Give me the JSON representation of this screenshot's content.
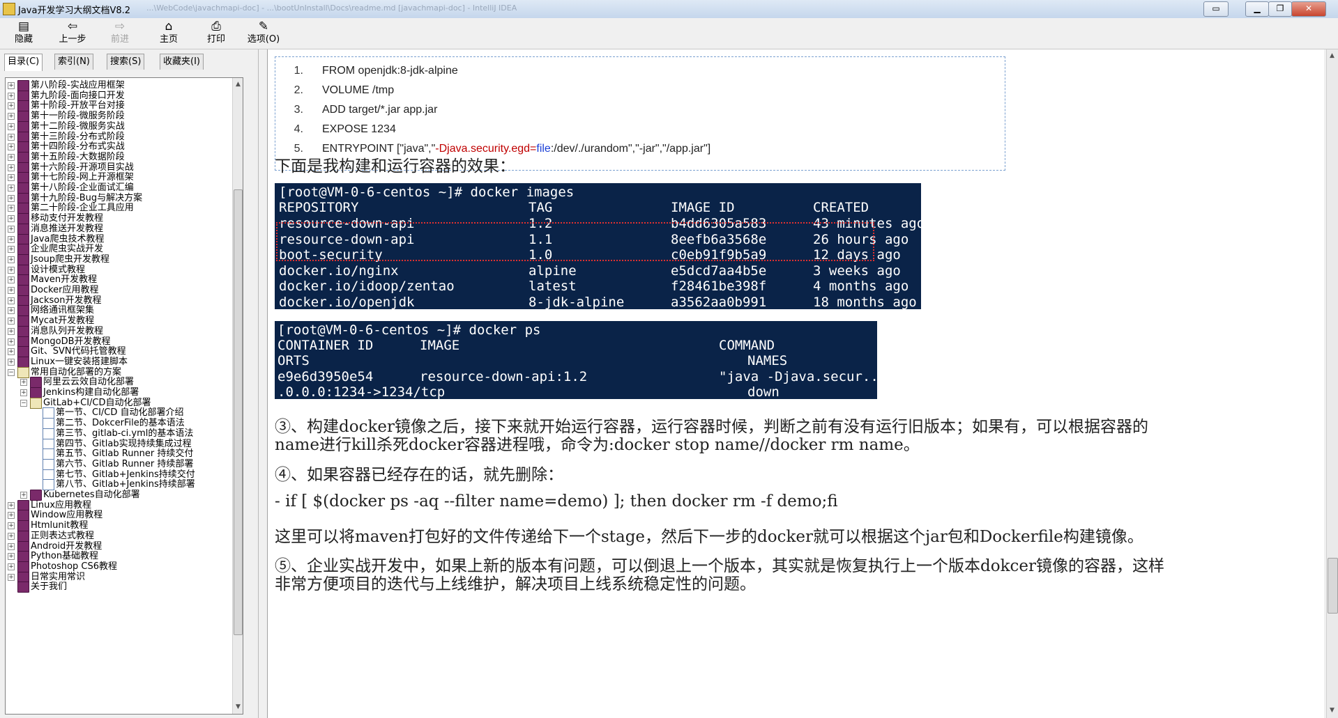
{
  "window": {
    "title": "Java开发学习大纲文档V8.2",
    "ghost_title": "...\\WebCode\\javachmapi-doc] - ...\\bootUnInstall\\Docs\\readme.md [javachmapi-doc] - IntelliJ IDEA"
  },
  "toolbar": {
    "items": [
      {
        "label": "隐藏",
        "icon": "▤"
      },
      {
        "label": "上一步",
        "icon": "⇦"
      },
      {
        "label": "前进",
        "icon": "⇨"
      },
      {
        "label": "主页",
        "icon": "⌂"
      },
      {
        "label": "打印",
        "icon": "⎙"
      },
      {
        "label": "选项(O)",
        "icon": "✎"
      }
    ]
  },
  "tabs": [
    {
      "label": "目录(C)"
    },
    {
      "label": "索引(N)"
    },
    {
      "label": "搜索(S)"
    },
    {
      "label": "收藏夹(I)"
    }
  ],
  "tree": [
    {
      "label": "第八阶段-实战应用框架",
      "icon": "book"
    },
    {
      "label": "第九阶段-面向接口开发",
      "icon": "book"
    },
    {
      "label": "第十阶段-开放平台对接",
      "icon": "book"
    },
    {
      "label": "第十一阶段-微服务阶段",
      "icon": "book"
    },
    {
      "label": "第十二阶段-微服务实战",
      "icon": "book"
    },
    {
      "label": "第十三阶段-分布式阶段",
      "icon": "book"
    },
    {
      "label": "第十四阶段-分布式实战",
      "icon": "book"
    },
    {
      "label": "第十五阶段-大数据阶段",
      "icon": "book"
    },
    {
      "label": "第十六阶段-开源项目实战",
      "icon": "book"
    },
    {
      "label": "第十七阶段-网上开源框架",
      "icon": "book"
    },
    {
      "label": "第十八阶段-企业面试汇编",
      "icon": "book"
    },
    {
      "label": "第十九阶段-Bug与解决方案",
      "icon": "book"
    },
    {
      "label": "第二十阶段-企业工具应用",
      "icon": "book"
    },
    {
      "label": "移动支付开发教程",
      "icon": "book"
    },
    {
      "label": "消息推送开发教程",
      "icon": "book"
    },
    {
      "label": "Java爬虫技术教程",
      "icon": "book"
    },
    {
      "label": "企业爬虫实战开发",
      "icon": "book"
    },
    {
      "label": "Jsoup爬虫开发教程",
      "icon": "book"
    },
    {
      "label": "设计模式教程",
      "icon": "book"
    },
    {
      "label": "Maven开发教程",
      "icon": "book"
    },
    {
      "label": "Docker应用教程",
      "icon": "book"
    },
    {
      "label": "Jackson开发教程",
      "icon": "book"
    },
    {
      "label": "网络通讯框架集",
      "icon": "book"
    },
    {
      "label": "Mycat开发教程",
      "icon": "book"
    },
    {
      "label": "消息队列开发教程",
      "icon": "book"
    },
    {
      "label": "MongoDB开发教程",
      "icon": "book"
    },
    {
      "label": "Git、SVN代码托管教程",
      "icon": "book"
    },
    {
      "label": "Linux一键安装搭建脚本",
      "icon": "book"
    },
    {
      "label": "常用自动化部署的方案",
      "icon": "open",
      "expanded": true
    },
    {
      "label": "阿里云云效自动化部署",
      "icon": "book",
      "level": 1
    },
    {
      "label": "Jenkins构建自动化部署",
      "icon": "book",
      "level": 1
    },
    {
      "label": "GitLab+CI/CD自动化部署",
      "icon": "open",
      "level": 1,
      "expanded": true
    },
    {
      "label": "第一节、CI/CD 自动化部署介绍",
      "icon": "page",
      "level": 2
    },
    {
      "label": "第二节、DokcerFile的基本语法",
      "icon": "page",
      "level": 2
    },
    {
      "label": "第三节、gitlab-ci.yml的基本语法",
      "icon": "page",
      "level": 2
    },
    {
      "label": "第四节、Gitlab实现持续集成过程",
      "icon": "page",
      "level": 2
    },
    {
      "label": "第五节、Gitlab Runner 持续交付",
      "icon": "page",
      "level": 2
    },
    {
      "label": "第六节、Gitlab Runner 持续部署",
      "icon": "page",
      "level": 2
    },
    {
      "label": "第七节、Gitlab+Jenkins持续交付",
      "icon": "page",
      "level": 2
    },
    {
      "label": "第八节、Gitlab+Jenkins持续部署",
      "icon": "page",
      "level": 2
    },
    {
      "label": "Kubernetes自动化部署",
      "icon": "book",
      "level": 1
    },
    {
      "label": "Linux应用教程",
      "icon": "book"
    },
    {
      "label": "Window应用教程",
      "icon": "book"
    },
    {
      "label": "Htmlunit教程",
      "icon": "book"
    },
    {
      "label": "正则表达式教程",
      "icon": "book"
    },
    {
      "label": "Android开发教程",
      "icon": "book"
    },
    {
      "label": "Python基础教程",
      "icon": "book"
    },
    {
      "label": "Photoshop CS6教程",
      "icon": "book"
    },
    {
      "label": "日常实用常识",
      "icon": "book"
    },
    {
      "label": "关于我们",
      "icon": "book",
      "no_expander": true
    }
  ],
  "code": {
    "lines": [
      {
        "num": "1.",
        "text": "FROM openjdk:8-jdk-alpine"
      },
      {
        "num": "2.",
        "text": "VOLUME /tmp"
      },
      {
        "num": "3.",
        "text": "ADD target/*.jar app.jar"
      },
      {
        "num": "4.",
        "text": "EXPOSE 1234"
      },
      {
        "num": "5.",
        "parts": [
          "ENTRYPOINT [\"java\",\"",
          "-Djava.security.egd=",
          "file",
          ":/dev/./urandom\",\"-jar\",\"/app.jar\"]"
        ]
      }
    ]
  },
  "para_effect": "下面是我构建和运行容器的效果：",
  "images_term": {
    "prompt": "[root@VM-0-6-centos ~]# docker images",
    "headers": [
      "REPOSITORY",
      "TAG",
      "IMAGE ID",
      "CREATED"
    ],
    "rows": [
      [
        "resource-down-api",
        "1.2",
        "b4dd6305a583",
        "43 minutes ago"
      ],
      [
        "resource-down-api",
        "1.1",
        "8eefb6a3568e",
        "26 hours ago"
      ],
      [
        "boot-security",
        "1.0",
        "c0eb91f9b5a9",
        "12 days ago"
      ],
      [
        "docker.io/nginx",
        "alpine",
        "e5dcd7aa4b5e",
        "3 weeks ago"
      ],
      [
        "docker.io/idoop/zentao",
        "latest",
        "f28461be398f",
        "4 months ago"
      ],
      [
        "docker.io/openjdk",
        "8-jdk-alpine",
        "a3562aa0b991",
        "18 months ago"
      ]
    ]
  },
  "ps_term": {
    "prompt": "[root@VM-0-6-centos ~]# docker ps",
    "line1": [
      "CONTAINER ID",
      "IMAGE",
      "COMMAND"
    ],
    "line2": [
      "ORTS",
      "NAMES"
    ],
    "line3": [
      "e9e6d3950e54",
      "resource-down-api:1.2",
      "\"java -Djava.secur...\""
    ],
    "line4": [
      ".0.0.0:1234->1234/tcp",
      "down"
    ]
  },
  "para3_line1": "③、构建docker镜像之后，接下来就开始运行容器，运行容器时候，判断之前有没有运行旧版本；如果有，可以根据容器的",
  "para3_line2": "name进行kill杀死docker容器进程哦，命令为:docker stop name//docker rm name。",
  "para4": "④、如果容器已经存在的话，就先删除：",
  "cmd_line": "- if [ $(docker ps -aq --filter name=demo) ]; then docker rm -f demo;fi",
  "para_maven": "这里可以将maven打包好的文件传递给下一个stage，然后下一步的docker就可以根据这个jar包和Dockerfile构建镜像。",
  "para5_line1": "⑤、企业实战开发中，如果上新的版本有问题，可以倒退上一个版本，其实就是恢复执行上一个版本dokcer镜像的容器，这样",
  "para5_line2": "非常方便项目的迭代与上线维护，解决项目上线系统稳定性的问题。"
}
